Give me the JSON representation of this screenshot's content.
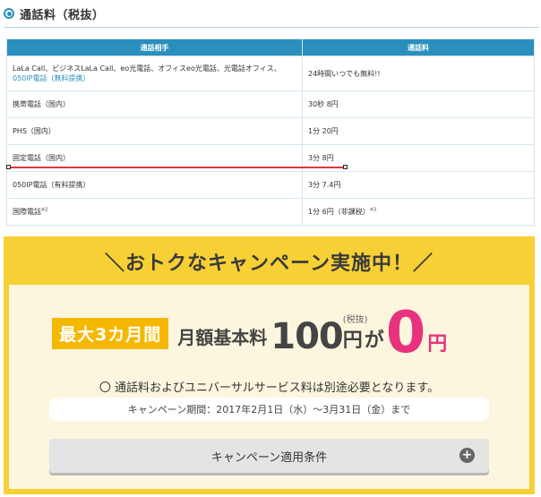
{
  "section": {
    "title": "通話料（税抜）"
  },
  "table": {
    "headers": [
      "通話相手",
      "通話料"
    ],
    "rows": [
      {
        "dest_line1": "LaLa Call、ビジネスLaLa Call、eo光電話、オフィスeo光電話、光電話オフィス、",
        "dest_line2": "050IP電話（無料提携）",
        "rate": "24時間いつでも無料!!"
      },
      {
        "dest": "携帯電話（国内）",
        "rate": "30秒 8円"
      },
      {
        "dest": "PHS（国内）",
        "rate": "1分 20円"
      },
      {
        "dest": "固定電話（国内）",
        "rate": "3分 8円"
      },
      {
        "dest": "050IP電話（有料提携）",
        "rate": "3分 7.4円"
      },
      {
        "dest": "国際電話",
        "dest_note": "※2",
        "rate": "1分 6円（非課税）",
        "rate_note": "※3"
      }
    ]
  },
  "campaign": {
    "title": "＼おトクなキャンペーン実施中！／",
    "badge": "最大3カ月間",
    "plan_label": "月額基本料",
    "old_price": "100",
    "tax_note": "(税抜)",
    "yen": "円",
    "particle": "が",
    "new_price": "0",
    "new_yen": "円",
    "note": "〇 通話料およびユニバーサルサービス料は別途必要となります。",
    "period": "キャンペーン期間：2017年2月1日（水）～3月31日（金）まで",
    "conditions_button": "キャンペーン適用条件"
  },
  "colors": {
    "header_blue": "#2a8fbd",
    "campaign_yellow": "#f7d035",
    "accent_pink": "#e8327e",
    "selection_red": "#d9393e"
  }
}
